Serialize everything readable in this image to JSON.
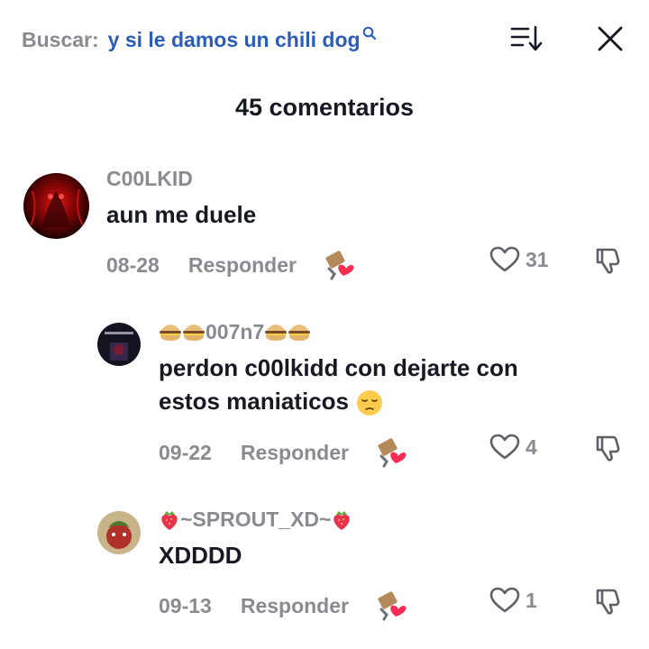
{
  "header": {
    "search_prefix": "Buscar:",
    "search_query": "y si le damos un chili dog",
    "comment_count": "45 comentarios"
  },
  "comments": [
    {
      "username": "C00LKID",
      "text": "aun me duele",
      "date": "08-28",
      "reply_label": "Responder",
      "likes": "31"
    },
    {
      "username": "007n7",
      "text_line1": "perdon c00lkidd con dejarte con",
      "text_line2": "estos maniaticos",
      "date": "09-22",
      "reply_label": "Responder",
      "likes": "4"
    },
    {
      "username": "~SPROUT_XD~",
      "text": "XDDDD",
      "date": "09-13",
      "reply_label": "Responder",
      "likes": "1"
    }
  ],
  "colors": {
    "accent_blue": "#2b5db8",
    "muted_gray": "#8a8b91",
    "text_dark": "#161823"
  }
}
